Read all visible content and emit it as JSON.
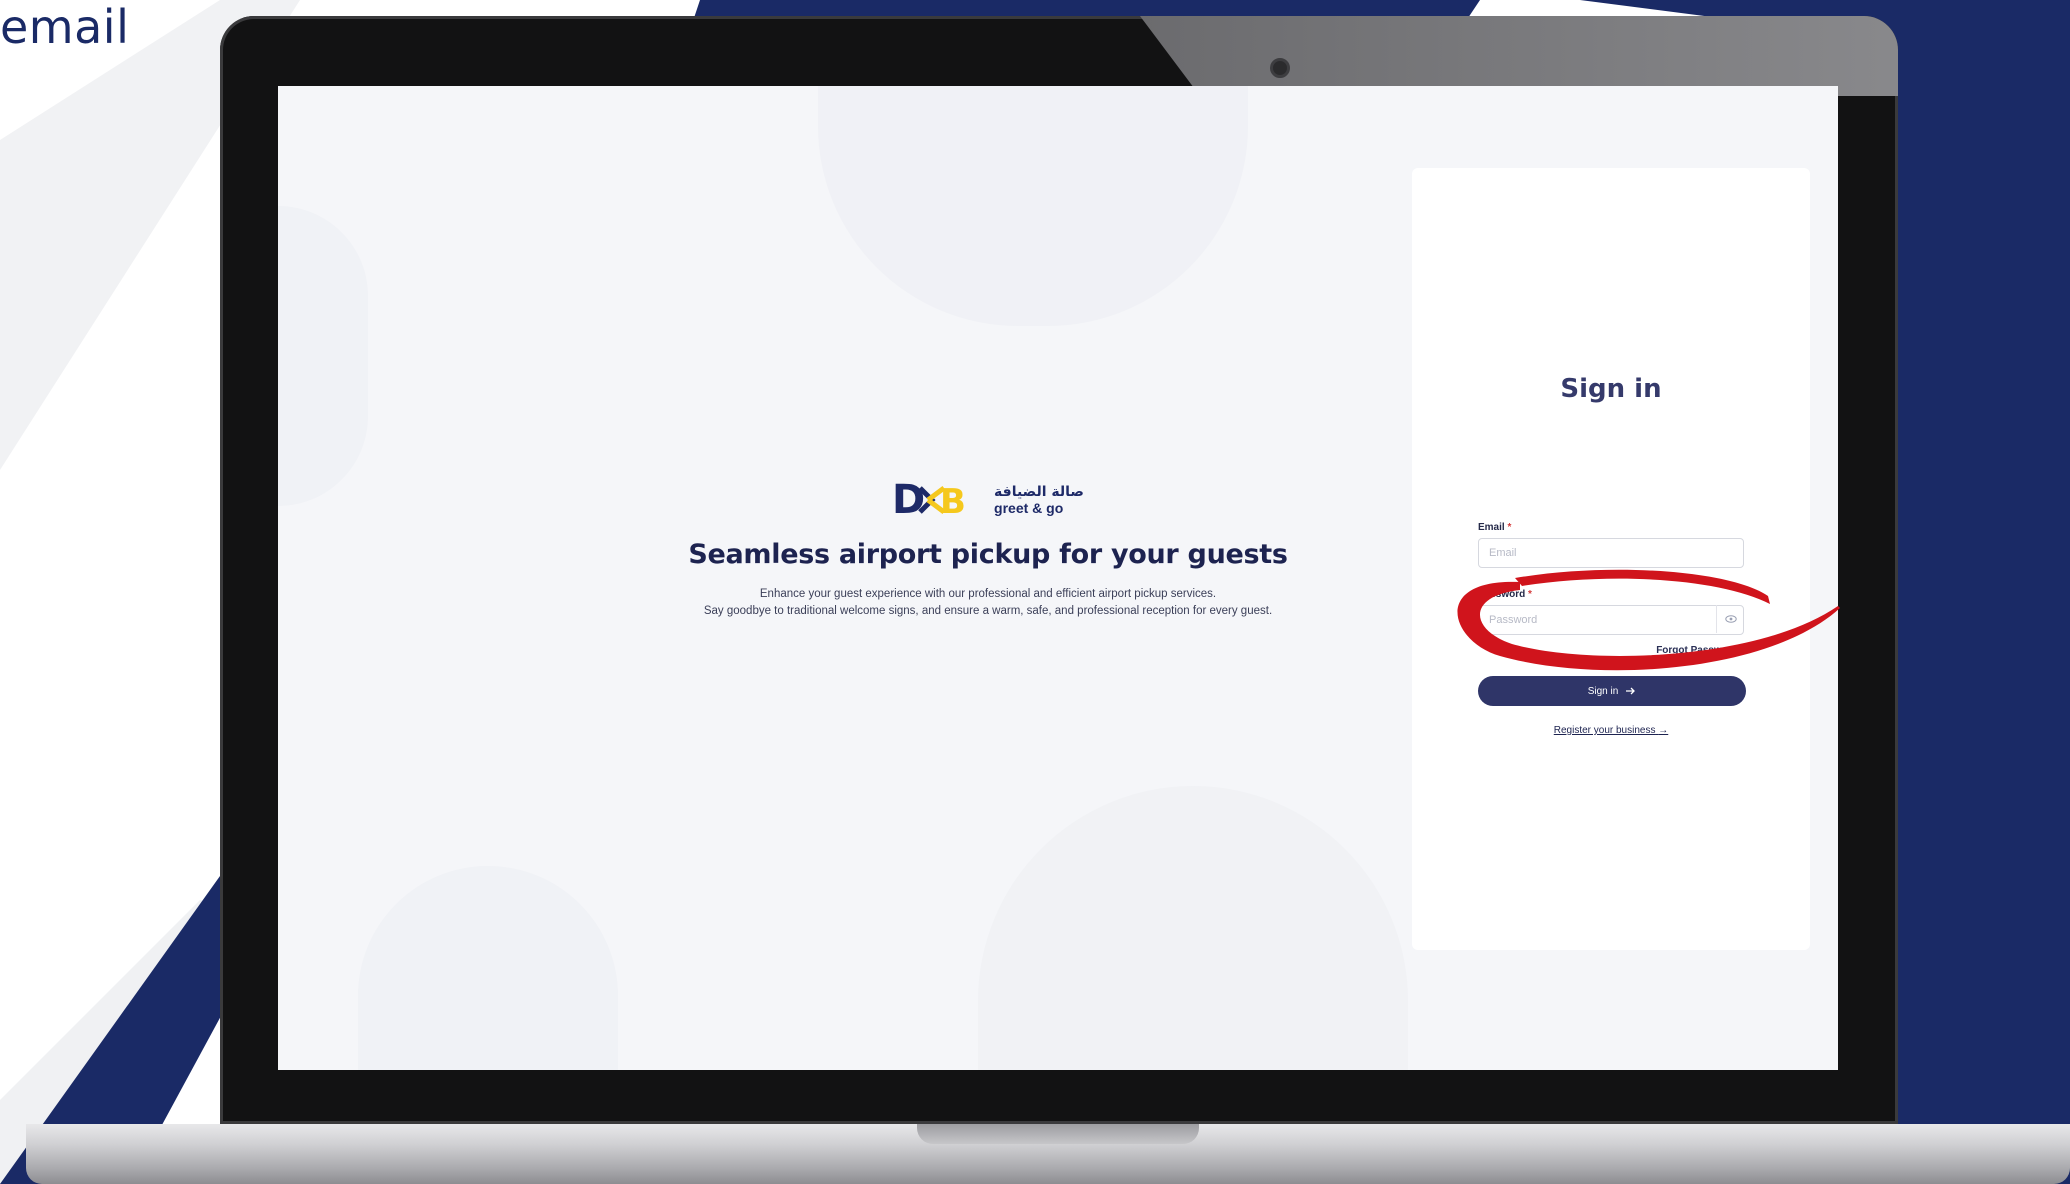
{
  "corner_text": "email",
  "hero": {
    "logo_arabic": "صالة الضيافة",
    "logo_english": "greet & go",
    "title": "Seamless airport pickup for your guests",
    "desc_line1": "Enhance your guest experience with our professional and efficient airport pickup services.",
    "desc_line2": "Say goodbye to traditional welcome signs, and ensure a warm, safe, and professional reception for every guest."
  },
  "signin": {
    "title": "Sign in",
    "email_label": "Email",
    "email_placeholder": "Email",
    "password_label": "Password",
    "password_placeholder": "Password",
    "required_mark": "*",
    "forgot_link": "Forgot Password?",
    "button_label": "Sign in",
    "register_link": "Register your business"
  },
  "colors": {
    "navy": "#1a2a66",
    "button": "#2f3568",
    "highlight_red": "#d0141c",
    "brand_yellow": "#f5c81d"
  },
  "icons": {
    "arrow": "arrow-right-icon",
    "eye": "eye-icon"
  }
}
